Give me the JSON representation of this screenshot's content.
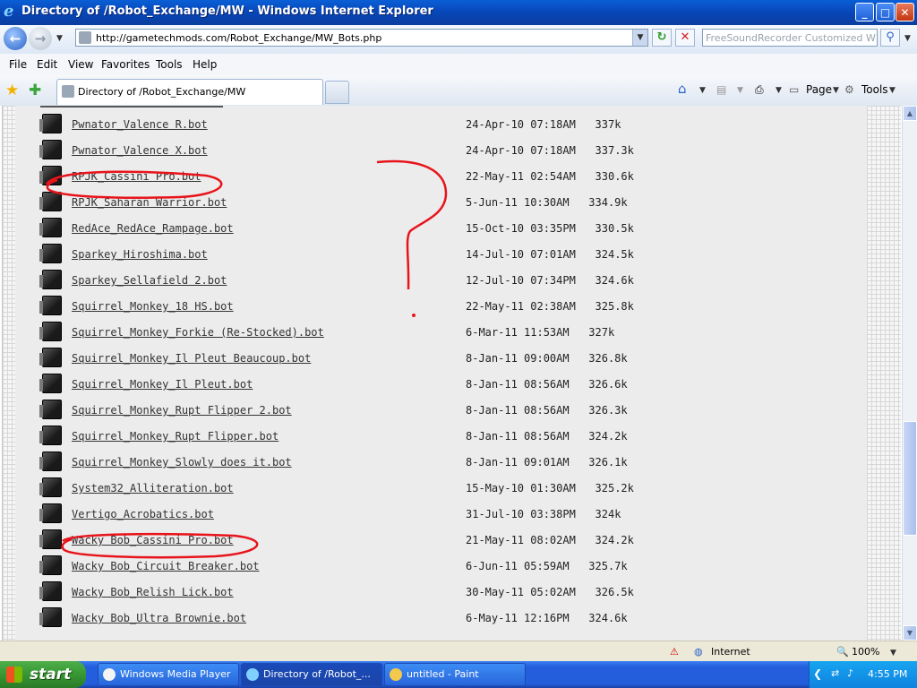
{
  "window": {
    "title": "Directory of /Robot_Exchange/MW - Windows Internet Explorer",
    "minimize": "_",
    "maximize": "□",
    "close": "✕"
  },
  "addressbar": {
    "url": "http://gametechmods.com/Robot_Exchange/MW_Bots.php",
    "search_placeholder": "FreeSoundRecorder Customized Web S"
  },
  "menu": [
    "File",
    "Edit",
    "View",
    "Favorites",
    "Tools",
    "Help"
  ],
  "tab": {
    "label": "Directory of /Robot_Exchange/MW"
  },
  "commandbar": {
    "page": "Page",
    "tools": "Tools"
  },
  "files": [
    {
      "name": "Pwnator_Valence R.bot",
      "date": "24-Apr-10 07:18AM",
      "size": "337k"
    },
    {
      "name": "Pwnator_Valence X.bot",
      "date": "24-Apr-10 07:18AM",
      "size": "337.3k"
    },
    {
      "name": "RPJK_Cassini Pro.bot",
      "date": "22-May-11 02:54AM",
      "size": "330.6k"
    },
    {
      "name": "RPJK_Saharan Warrior.bot",
      "date": "5-Jun-11 10:30AM",
      "size": "334.9k"
    },
    {
      "name": "RedAce_RedAce_Rampage.bot",
      "date": "15-Oct-10 03:35PM",
      "size": "330.5k"
    },
    {
      "name": "Sparkey_Hiroshima.bot",
      "date": "14-Jul-10 07:01AM",
      "size": "324.5k"
    },
    {
      "name": "Sparkey_Sellafield 2.bot",
      "date": "12-Jul-10 07:34PM",
      "size": "324.6k"
    },
    {
      "name": "Squirrel_Monkey_18 HS.bot",
      "date": "22-May-11 02:38AM",
      "size": "325.8k"
    },
    {
      "name": "Squirrel_Monkey_Forkie (Re-Stocked).bot",
      "date": "6-Mar-11 11:53AM",
      "size": "327k"
    },
    {
      "name": "Squirrel_Monkey_Il Pleut Beaucoup.bot",
      "date": "8-Jan-11 09:00AM",
      "size": "326.8k"
    },
    {
      "name": "Squirrel_Monkey_Il Pleut.bot",
      "date": "8-Jan-11 08:56AM",
      "size": "326.6k"
    },
    {
      "name": "Squirrel_Monkey_Rupt Flipper 2.bot",
      "date": "8-Jan-11 08:56AM",
      "size": "326.3k"
    },
    {
      "name": "Squirrel_Monkey_Rupt Flipper.bot",
      "date": "8-Jan-11 08:56AM",
      "size": "324.2k"
    },
    {
      "name": "Squirrel_Monkey_Slowly does it.bot",
      "date": "8-Jan-11 09:01AM",
      "size": "326.1k"
    },
    {
      "name": "System32_Alliteration.bot",
      "date": "15-May-10 01:30AM",
      "size": "325.2k"
    },
    {
      "name": "Vertigo_Acrobatics.bot",
      "date": "31-Jul-10 03:38PM",
      "size": "324k"
    },
    {
      "name": "Wacky Bob_Cassini Pro.bot",
      "date": "21-May-11 08:02AM",
      "size": "324.2k"
    },
    {
      "name": "Wacky Bob_Circuit Breaker.bot",
      "date": "6-Jun-11 05:59AM",
      "size": "325.7k"
    },
    {
      "name": "Wacky Bob_Relish Lick.bot",
      "date": "30-May-11 05:02AM",
      "size": "326.5k"
    },
    {
      "name": "Wacky Bob_Ultra Brownie.bot",
      "date": "6-May-11 12:16PM",
      "size": "324.6k"
    }
  ],
  "annotations": {
    "question_mark": "?",
    "ink_color": "#e8141b"
  },
  "status": {
    "zone": "Internet",
    "zoom": "100%"
  },
  "taskbar": {
    "start": "start",
    "items": [
      "Windows Media Player",
      "Directory of /Robot_...",
      "untitled - Paint"
    ],
    "clock": "4:55 PM"
  },
  "colors": {
    "title_blue": "#0846b8",
    "taskbar_blue": "#245edc",
    "start_green": "#3a9c36"
  }
}
